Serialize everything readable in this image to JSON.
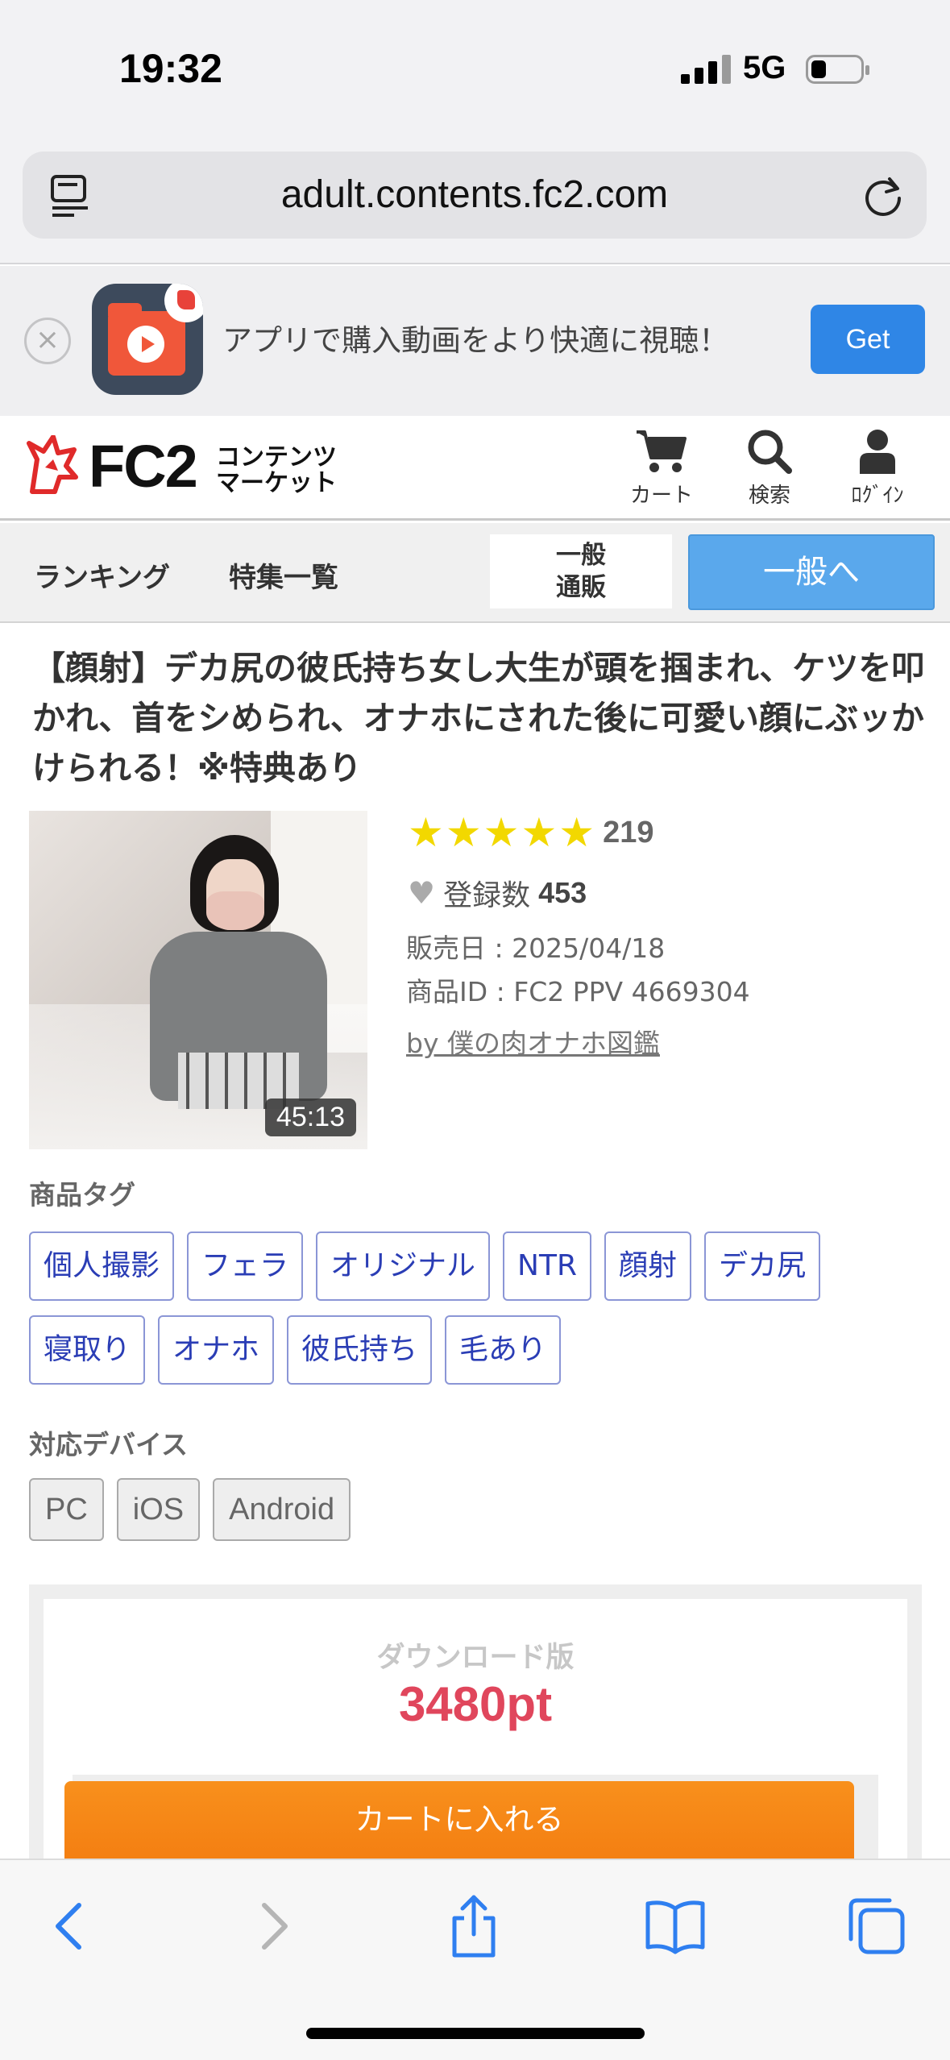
{
  "status_bar": {
    "time": "19:32",
    "network": "5G"
  },
  "browser": {
    "url": "adult.contents.fc2.com"
  },
  "app_banner": {
    "text": "アプリで購入動画をより快適に視聴！",
    "get_label": "Get"
  },
  "site_header": {
    "logo_text": "FC2",
    "logo_sub_line1": "コンテンツ",
    "logo_sub_line2": "マーケット",
    "cart_label": "カート",
    "search_label": "検索",
    "login_label": "ﾛｸﾞｲﾝ"
  },
  "nav": {
    "ranking": "ランキング",
    "features": "特集一覧",
    "mode_line1": "一般",
    "mode_line2": "通販",
    "mode_button": "一般へ"
  },
  "product": {
    "title": "【顔射】デカ尻の彼氏持ち女し大生が頭を掴まれ、ケツを叩かれ、首をシめられ、オナホにされた後に可愛い顔にぶッかけられる！※特典あり",
    "duration": "45:13",
    "stars": "★★★★★",
    "rating_count": "219",
    "favorites_label": "登録数",
    "favorites_count": "453",
    "release": "販売日 : 2025/04/18",
    "product_id": "商品ID : FC2 PPV 4669304",
    "seller": "by 僕の肉オナホ図鑑"
  },
  "tags_section": {
    "label": "商品タグ",
    "tags": [
      "個人撮影",
      "フェラ",
      "オリジナル",
      "NTR",
      "顔射",
      "デカ尻",
      "寝取り",
      "オナホ",
      "彼氏持ち",
      "毛あり"
    ]
  },
  "devices_section": {
    "label": "対応デバイス",
    "devices": [
      "PC",
      "iOS",
      "Android"
    ]
  },
  "purchase": {
    "version_label": "ダウンロード版",
    "price": "3480pt",
    "cart_button": "カートに入れる"
  },
  "colors": {
    "accent_blue": "#2f86e6",
    "price_red": "#e0465c",
    "cart_orange": "#f47f12",
    "tag_blue": "#2a3db5",
    "star_yellow": "#f2d800"
  }
}
